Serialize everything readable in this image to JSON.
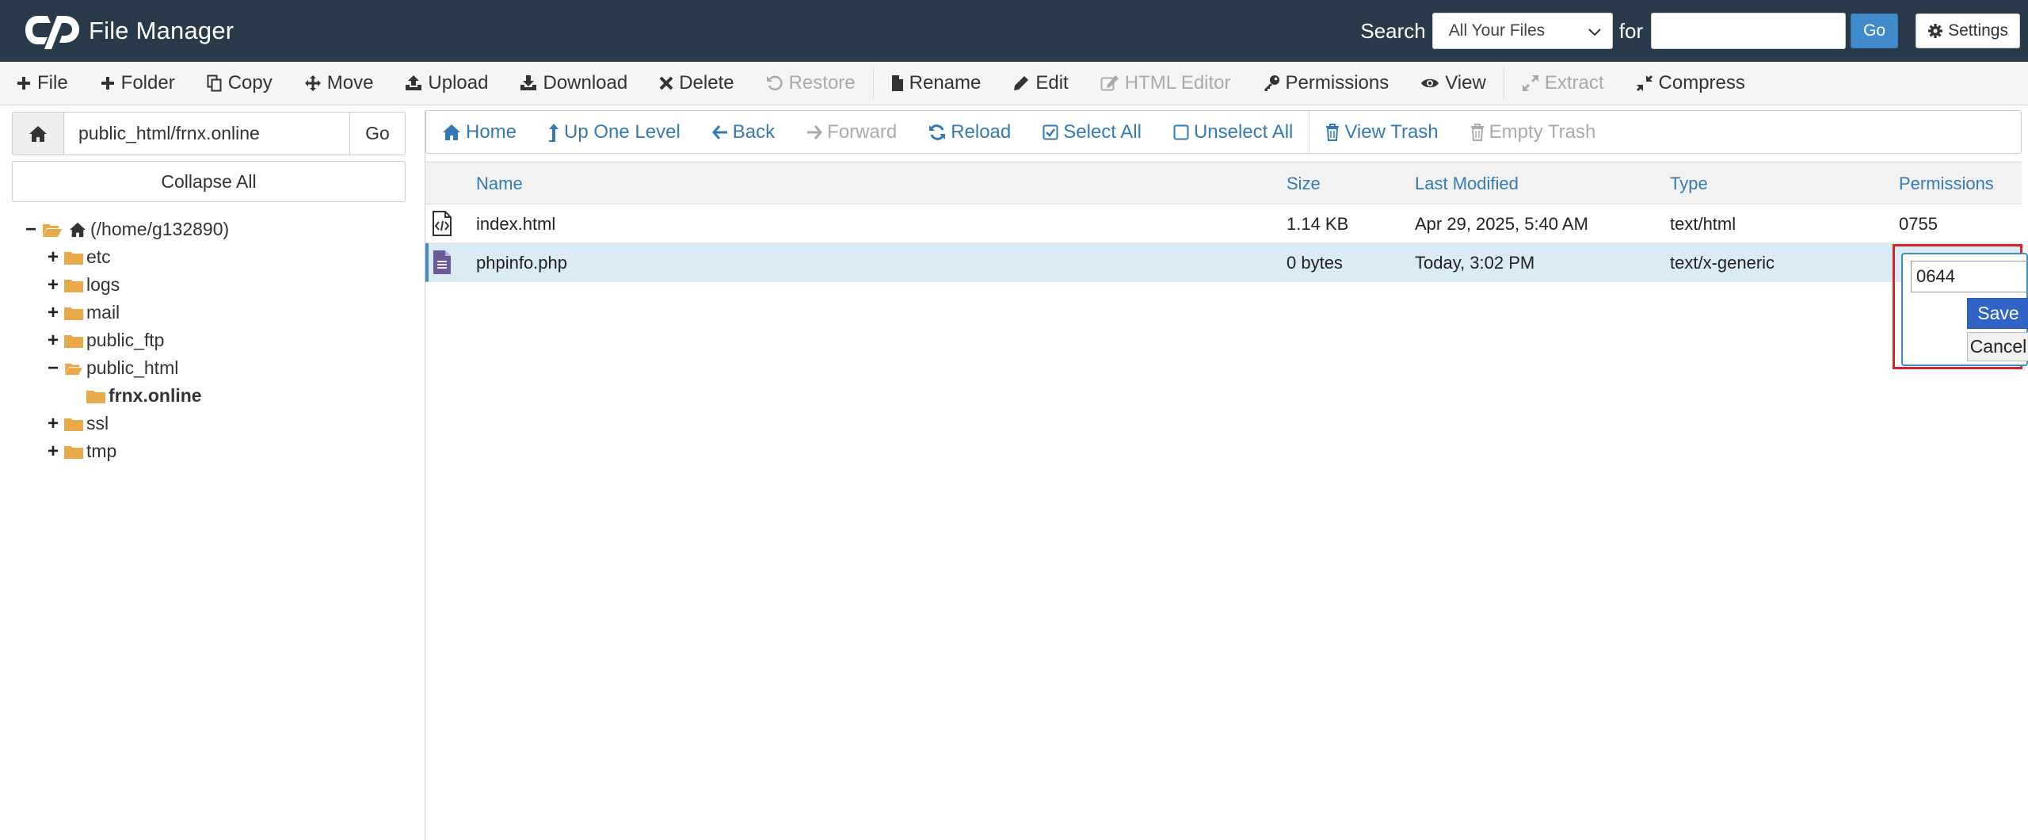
{
  "header": {
    "title": "File Manager",
    "search_label": "Search",
    "search_scope": "All Your Files",
    "for_label": "for",
    "search_value": "",
    "go_label": "Go",
    "settings_label": "Settings"
  },
  "toolbar": {
    "items": [
      {
        "label": "File",
        "icon": "plus-icon",
        "disabled": false
      },
      {
        "label": "Folder",
        "icon": "plus-icon",
        "disabled": false
      },
      {
        "label": "Copy",
        "icon": "copy-icon",
        "disabled": false
      },
      {
        "label": "Move",
        "icon": "move-icon",
        "disabled": false
      },
      {
        "label": "Upload",
        "icon": "upload-icon",
        "disabled": false
      },
      {
        "label": "Download",
        "icon": "download-icon",
        "disabled": false
      },
      {
        "label": "Delete",
        "icon": "close-icon",
        "disabled": false
      },
      {
        "label": "Restore",
        "icon": "undo-icon",
        "disabled": true
      },
      {
        "label": "Rename",
        "icon": "file-icon",
        "disabled": false
      },
      {
        "label": "Edit",
        "icon": "pencil-icon",
        "disabled": false
      },
      {
        "label": "HTML Editor",
        "icon": "edit-square-icon",
        "disabled": true
      },
      {
        "label": "Permissions",
        "icon": "key-icon",
        "disabled": false
      },
      {
        "label": "View",
        "icon": "eye-icon",
        "disabled": false
      },
      {
        "label": "Extract",
        "icon": "expand-icon",
        "disabled": true
      },
      {
        "label": "Compress",
        "icon": "compress-icon",
        "disabled": false
      }
    ]
  },
  "sidebar": {
    "path": "public_html/frnx.online",
    "go_label": "Go",
    "collapse_label": "Collapse All",
    "tree": {
      "root": "(/home/g132890)",
      "etc": "etc",
      "logs": "logs",
      "mail": "mail",
      "public_ftp": "public_ftp",
      "public_html": "public_html",
      "frnx": "frnx.online",
      "ssl": "ssl",
      "tmp": "tmp"
    }
  },
  "nav": {
    "home": "Home",
    "up": "Up One Level",
    "back": "Back",
    "forward": "Forward",
    "reload": "Reload",
    "select_all": "Select All",
    "unselect_all": "Unselect All",
    "view_trash": "View Trash",
    "empty_trash": "Empty Trash"
  },
  "table": {
    "headers": {
      "name": "Name",
      "size": "Size",
      "modified": "Last Modified",
      "type": "Type",
      "perms": "Permissions"
    },
    "rows": [
      {
        "name": "index.html",
        "size": "1.14 KB",
        "modified": "Apr 29, 2025, 5:40 AM",
        "type": "text/html",
        "perms": "0755",
        "icon": "html-file-icon"
      },
      {
        "name": "phpinfo.php",
        "size": "0 bytes",
        "modified": "Today, 3:02 PM",
        "type": "text/x-generic",
        "perms": "",
        "icon": "text-file-icon"
      }
    ]
  },
  "perm_editor": {
    "value": "0644",
    "save_label": "Save",
    "cancel_label": "Cancel"
  },
  "colors": {
    "header_bg": "#293a4a",
    "link": "#337ab7",
    "primary": "#428bca",
    "highlight": "#d9232b",
    "folder": "#e8a94b"
  }
}
